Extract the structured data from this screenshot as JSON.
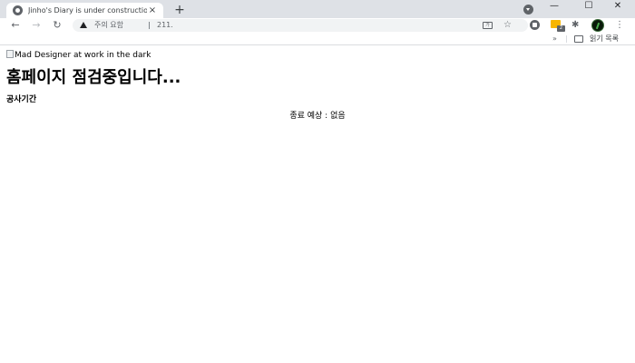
{
  "browser": {
    "tab_title": "Jinho's Diary is under construction",
    "tab_close": "×",
    "new_tab": "+",
    "window_min": "—",
    "window_max": "☐",
    "window_close": "✕",
    "nav_back": "←",
    "nav_forward": "→",
    "nav_reload": "↻",
    "omnibox_warning": "주의 요함",
    "omnibox_url": "211.",
    "star": "☆",
    "ext_badge": "2",
    "puzzle": "✱",
    "menu": "⋮",
    "bookmarks_overflow": "»",
    "reading_list": "읽기 목록",
    "translate_glyph": "가"
  },
  "page": {
    "image_alt": "Mad Designer at work in the dark",
    "title": "홈페이지 점검중입니다...",
    "section_label": "공사기간",
    "expected_end": "종료 예상 : 없음"
  },
  "colors": {
    "chrome_background": "#dee1e6",
    "omnibox_background": "#f1f3f4",
    "extension_yellow": "#f7b500"
  }
}
